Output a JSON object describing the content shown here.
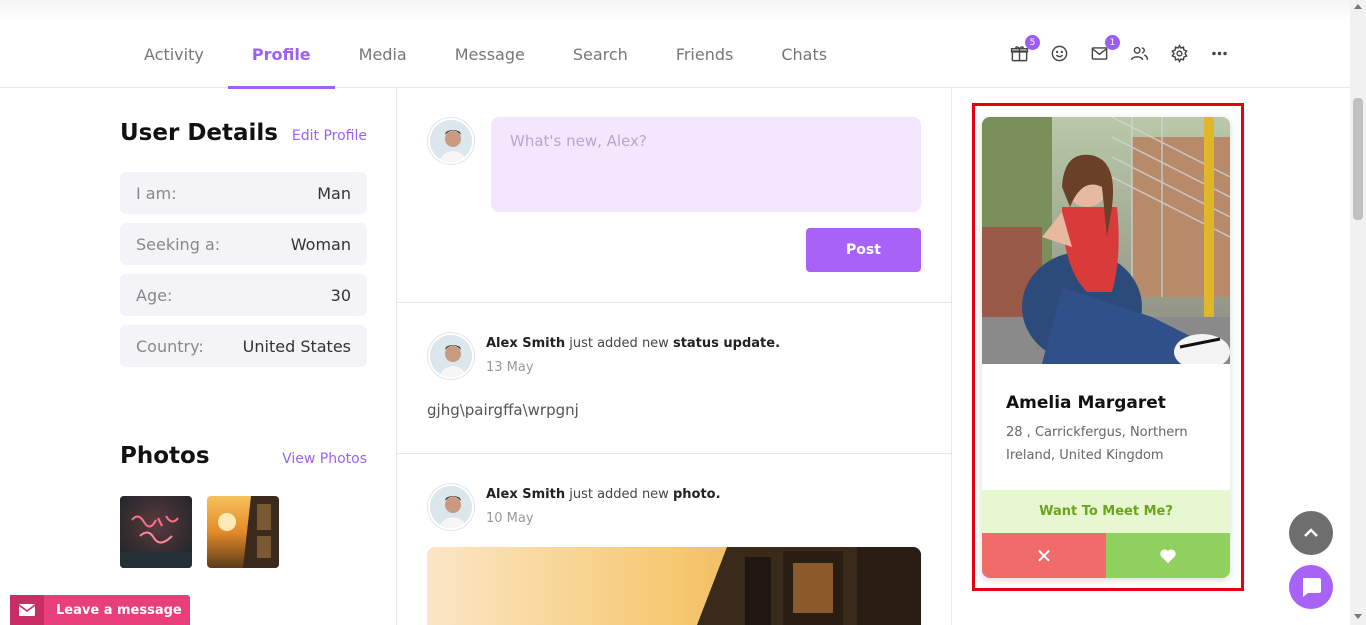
{
  "nav": {
    "tabs": [
      {
        "label": "Activity"
      },
      {
        "label": "Profile",
        "active": true
      },
      {
        "label": "Media"
      },
      {
        "label": "Message"
      },
      {
        "label": "Search"
      },
      {
        "label": "Friends"
      },
      {
        "label": "Chats"
      }
    ],
    "icons": [
      {
        "name": "gift-icon",
        "badge": "5"
      },
      {
        "name": "smiley-icon"
      },
      {
        "name": "mail-icon",
        "badge": "1"
      },
      {
        "name": "friends-icon"
      },
      {
        "name": "settings-icon"
      },
      {
        "name": "more-icon"
      }
    ]
  },
  "user_details": {
    "title": "User Details",
    "edit_link": "Edit Profile",
    "rows": [
      {
        "key": "I am:",
        "value": "Man"
      },
      {
        "key": "Seeking a:",
        "value": "Woman"
      },
      {
        "key": "Age:",
        "value": "30"
      },
      {
        "key": "Country:",
        "value": "United States"
      }
    ]
  },
  "photos": {
    "title": "Photos",
    "view_link": "View Photos"
  },
  "leave_message": {
    "label": "Leave a message"
  },
  "composer": {
    "placeholder": "What's new, Alex?",
    "post_label": "Post"
  },
  "activity": [
    {
      "user": "Alex Smith",
      "action": "just added new",
      "object": "status update.",
      "date": "13 May",
      "text": "gjhg\\pairgffa\\wrpgnj"
    },
    {
      "user": "Alex Smith",
      "action": "just added new",
      "object": "photo.",
      "date": "10 May"
    }
  ],
  "match_card": {
    "name": "Amelia Margaret",
    "location": "28 , Carrickfergus, Northern Ireland, United Kingdom",
    "prompt": "Want To Meet Me?",
    "reject_symbol": "✕"
  },
  "colors": {
    "accent": "#a061f2",
    "reject": "#f26b6b",
    "accept": "#8fd05e",
    "highlight": "#e3000f",
    "leave": "#e83e7a"
  }
}
